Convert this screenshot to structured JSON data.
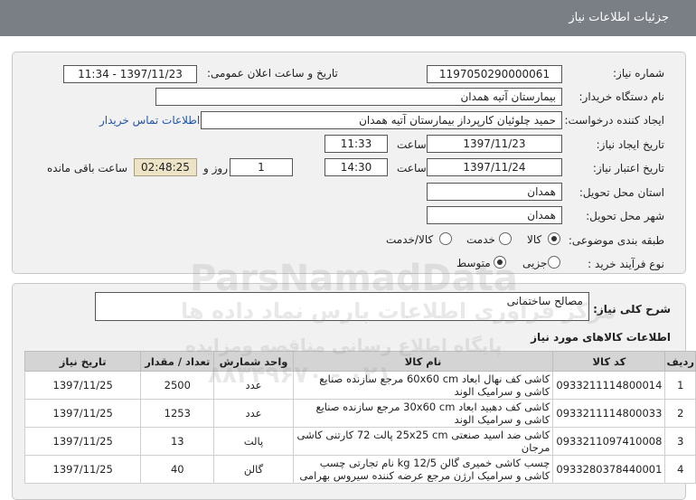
{
  "header": {
    "title": "جزئیات اطلاعات نیاز"
  },
  "need_info": {
    "need_number_label": "شماره نیاز:",
    "need_number": "1197050290000061",
    "announce_label": "تاریخ و ساعت اعلان عمومی:",
    "announce_value": "1397/11/23 - 11:34",
    "buyer_org_label": "نام دستگاه خریدار:",
    "buyer_org": "بیمارستان آتیه همدان",
    "requester_label": "ایجاد کننده درخواست:",
    "requester": "حمید چلوئیان   کارپرداز بیمارستان آتیه همدان",
    "contact_link": "اطلاعات تماس خریدار",
    "created_label": "تاریخ ایجاد نیاز:",
    "created_date": "1397/11/23",
    "time_label": "ساعت",
    "created_time": "11:33",
    "validity_label": "تاریخ اعتبار نیاز:",
    "validity_date": "1397/11/24",
    "validity_time": "14:30",
    "days_value": "1",
    "days_label": "روز و",
    "remaining": "02:48:25",
    "remaining_label": "ساعت باقی مانده",
    "province_label": "استان محل تحویل:",
    "province": "همدان",
    "city_label": "شهر محل تحویل:",
    "city": "همدان",
    "category_label": "طبقه بندی موضوعی:",
    "category_options": [
      "کالا",
      "خدمت",
      "کالا/خدمت"
    ],
    "category_selected": "کالا",
    "process_label": "نوع فرآیند خرید :",
    "process_options": [
      "جزیی",
      "متوسط"
    ],
    "process_selected": "متوسط"
  },
  "summary": {
    "label": "شرح کلی نیاز:",
    "value": "مصالح ساختمانی"
  },
  "goods": {
    "section_title": "اطلاعات کالاهای مورد نیاز",
    "columns": [
      "ردیف",
      "کد کالا",
      "نام کالا",
      "واحد شمارش",
      "تعداد / مقدار",
      "تاریخ نیاز"
    ],
    "rows": [
      {
        "idx": "1",
        "code": "0933211114800014",
        "name": "کاشی کف نهال ابعاد 60x60 cm مرجع سازنده صنایع کاشی و سرامیک الوند",
        "unit": "عدد",
        "qty": "2500",
        "date": "1397/11/25"
      },
      {
        "idx": "2",
        "code": "0933211114800033",
        "name": "کاشی کف دهبید ابعاد 30x60 cm مرجع سازنده صنایع کاشی و سرامیک الوند",
        "unit": "عدد",
        "qty": "1253",
        "date": "1397/11/25"
      },
      {
        "idx": "3",
        "code": "0933211097410008",
        "name": "کاشی ضد اسید صنعتی 25x25 cm پالت 72 کارتنی کاشی مرجان",
        "unit": "پالت",
        "qty": "13",
        "date": "1397/11/25"
      },
      {
        "idx": "4",
        "code": "0933280378440001",
        "name": "چسب کاشی خمیری گالن 12/5 kg نام تجارتی چسب کاشی و سرامیک ارژن مرجع عرضه کننده سیروس بهرامی",
        "unit": "گالن",
        "qty": "40",
        "date": "1397/11/25"
      }
    ]
  },
  "watermark": {
    "brand": "ParsNamadData",
    "line1": "مرکز فرآوری اطلاعات پارس نماد داده ها",
    "line2": "پایگاه اطلاع رسانی مناقصه ومزایده",
    "phone": "۰۲۱ - ۸۸۳۴۹۶۷۰"
  }
}
